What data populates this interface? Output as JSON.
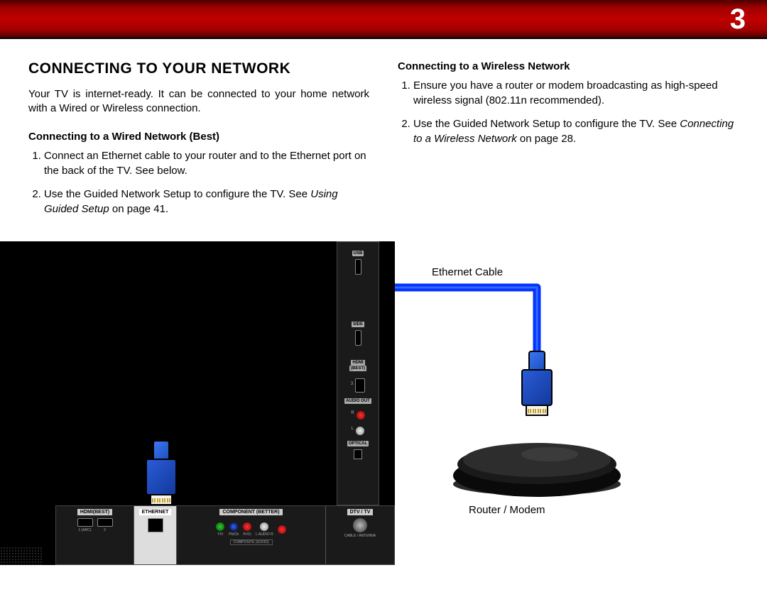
{
  "page_number": "3",
  "title": "CONNECTING TO YOUR NETWORK",
  "intro": "Your TV is internet-ready. It can be connected to your home network with a Wired or Wireless connection.",
  "wired": {
    "heading": "Connecting to a Wired Network (Best)",
    "step1": "Connect an Ethernet cable to your router and to the Ethernet port on the back of the TV. See below.",
    "step2_a": "Use the Guided Network Setup to configure the TV. See ",
    "step2_i": "Using Guided Setup",
    "step2_b": " on page 41."
  },
  "wireless": {
    "heading": "Connecting to a Wireless Network",
    "step1": "Ensure you have a router or modem broadcasting as high-speed wireless signal (802.11n recommended).",
    "step2_a": "Use the Guided Network Setup to configure the TV. See ",
    "step2_i": "Connecting to a Wireless Network",
    "step2_b": " on page 28."
  },
  "diagram": {
    "ethernet_cable": "Ethernet Cable",
    "router_modem": "Router / Modem",
    "side_ports": {
      "usb": "USB",
      "side": "SIDE",
      "hdmi": "HDMI",
      "best": "(BEST)",
      "num3": "3",
      "audio_out": "AUDIO OUT",
      "r": "R",
      "l": "L",
      "optical": "OPTICAL"
    },
    "bottom_ports": {
      "hdmi_best": "HDMI(BEST)",
      "n1_arc": "1 (ARC)",
      "n2": "2",
      "ethernet": "ETHERNET",
      "component": "COMPONENT (BETTER)",
      "y_v": "Y/V",
      "pb": "Pb/Cb",
      "pr": "Pr/Cr",
      "laudio": "L AUDIO R",
      "composite": "COMPOSITE (GOOD)",
      "dtv": "DTV / TV",
      "cable": "CABLE / ANTENNA"
    }
  }
}
